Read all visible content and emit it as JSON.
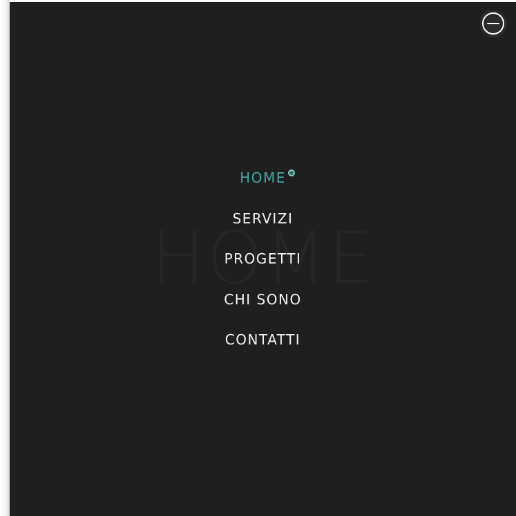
{
  "background_word": "HOME",
  "menu": {
    "items": [
      {
        "label": "HOME",
        "active": true
      },
      {
        "label": "SERVIZI",
        "active": false
      },
      {
        "label": "PROGETTI",
        "active": false
      },
      {
        "label": "CHI SONO",
        "active": false
      },
      {
        "label": "CONTATTI",
        "active": false
      }
    ]
  },
  "close_button": {
    "icon": "minus-circle-icon"
  },
  "colors": {
    "overlay_bg": "#1f1f1f",
    "accent": "#3fa8a0",
    "text": "#f2f2f2"
  }
}
